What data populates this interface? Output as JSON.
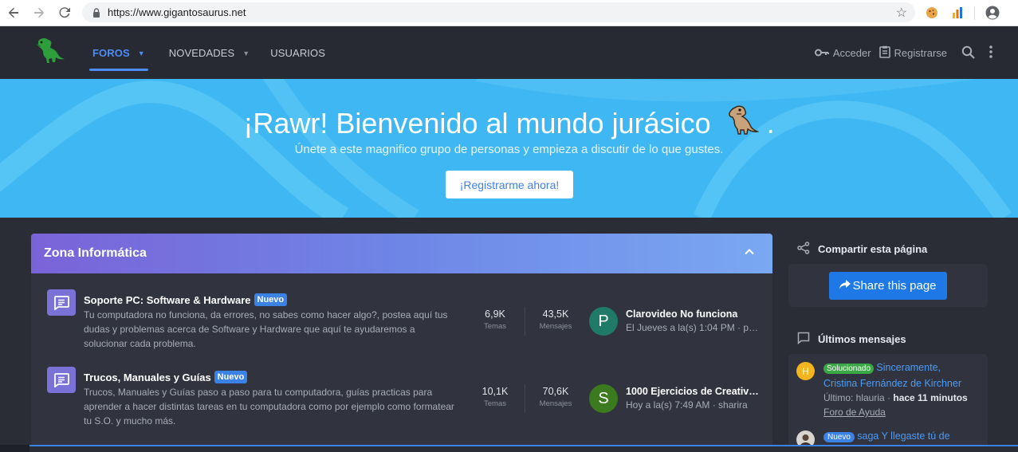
{
  "browser": {
    "url": "https://www.gigantosaurus.net",
    "back_icon": "back-arrow-icon",
    "forward_icon": "forward-arrow-icon",
    "reload_icon": "reload-icon"
  },
  "header": {
    "nav": [
      {
        "label": "FOROS",
        "active": true
      },
      {
        "label": "NOVEDADES",
        "active": false
      },
      {
        "label": "USUARIOS",
        "active": false
      }
    ],
    "login_label": "Acceder",
    "register_label": "Registrarse"
  },
  "hero": {
    "title": "¡Rawr! Bienvenido al mundo jurásico",
    "title_suffix": ".",
    "subtitle": "Únete a este magnifico grupo de personas y empieza a discutir de lo que gustes.",
    "button_label": "¡Registrarme ahora!"
  },
  "block": {
    "title": "Zona Informática",
    "nodes": [
      {
        "title": "Soporte PC: Software & Hardware",
        "badge": "Nuevo",
        "description": "Tu computadora no funciona, da errores, no sabes como hacer algo?, postea aquí tus dudas y problemas acerca de Software y Hardware que aquí te ayudaremos a solucionar cada problema.",
        "temas_value": "6,9K",
        "temas_label": "Temas",
        "mensajes_value": "43,5K",
        "mensajes_label": "Mensajes",
        "avatar_letter": "P",
        "avatar_color": "#1f7a68",
        "last_title": "Clarovideo No funciona",
        "last_meta": "El Jueves a la(s) 1:04 PM · pa..."
      },
      {
        "title": "Trucos, Manuales y Guías",
        "badge": "Nuevo",
        "description": "Trucos, Manuales y Guías paso a paso para tu computadora, guías practicas para aprender a hacer distintas tareas en tu computadora como por ejemplo como formatear tu S.O. y mucho más.",
        "temas_value": "10,1K",
        "temas_label": "Temas",
        "mensajes_value": "70,6K",
        "mensajes_label": "Mensajes",
        "avatar_letter": "S",
        "avatar_color": "#3b7a1e",
        "last_title": "1000 Ejercicios de Creatividad...",
        "last_meta": "Hoy a la(s) 7:49 AM · sharira"
      }
    ]
  },
  "sidebar": {
    "share": {
      "heading": "Compartir esta página",
      "button_label": "Share this page"
    },
    "latest": {
      "heading": "Últimos mensajes",
      "items": [
        {
          "badge": "Solucionado",
          "title": "Sinceramente, Cristina Fernández de Kirchner",
          "meta_prefix": "Último: hlauria · ",
          "time": "hace 11 minutos",
          "forum": "Foro de Ayuda",
          "avatar_letter": "H",
          "avatar_color": "#f2b51d"
        },
        {
          "badge": "Nuevo",
          "title": "saga Y llegaste tú de",
          "avatar_color": "#d8d4cf"
        }
      ]
    }
  },
  "colors": {
    "accent": "#4c8df6",
    "hero_bg": "#3fb7f3",
    "page_bg": "#2a2d36",
    "block_bg": "#31343e"
  }
}
